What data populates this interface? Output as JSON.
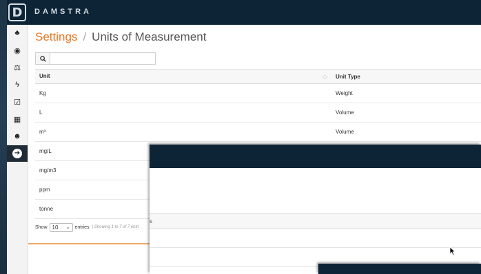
{
  "app": {
    "brand": "DAMSTRA",
    "logo_letter": "D"
  },
  "sidebar": {
    "items": [
      {
        "name": "sitemap-icon",
        "glyph": "♣"
      },
      {
        "name": "dashboard-icon",
        "glyph": "◉"
      },
      {
        "name": "balance-scale-icon",
        "glyph": "⚖"
      },
      {
        "name": "bolt-icon",
        "glyph": "ϟ"
      },
      {
        "name": "check-square-icon",
        "glyph": "☑"
      },
      {
        "name": "building-icon",
        "glyph": "▦"
      },
      {
        "name": "users-icon",
        "glyph": "☻"
      },
      {
        "name": "arrow-circle-right-icon",
        "glyph": "➔",
        "active": true
      }
    ]
  },
  "breadcrumb": {
    "parent": "Settings",
    "separator": "/",
    "current": "Units of Measurement"
  },
  "search": {
    "value": "",
    "placeholder": ""
  },
  "table": {
    "columns": [
      "Unit",
      "Unit Type"
    ],
    "rows": [
      {
        "unit": "Kg",
        "type": "Weight"
      },
      {
        "unit": "L",
        "type": "Volume"
      },
      {
        "unit": "m³",
        "type": "Volume"
      },
      {
        "unit": "mg/L",
        "type": ""
      },
      {
        "unit": "mg/m3",
        "type": ""
      },
      {
        "unit": "ppm",
        "type": ""
      },
      {
        "unit": "tonne",
        "type": ""
      }
    ]
  },
  "footer": {
    "show_label": "Show",
    "page_length": "10",
    "entries_label": "entries",
    "separator": "|",
    "info": "Showing 1 to 7 of 7 entri"
  },
  "overlay": {
    "header_fragment": "s"
  },
  "colors": {
    "accent": "#e87722",
    "navbar": "#0d2436"
  }
}
